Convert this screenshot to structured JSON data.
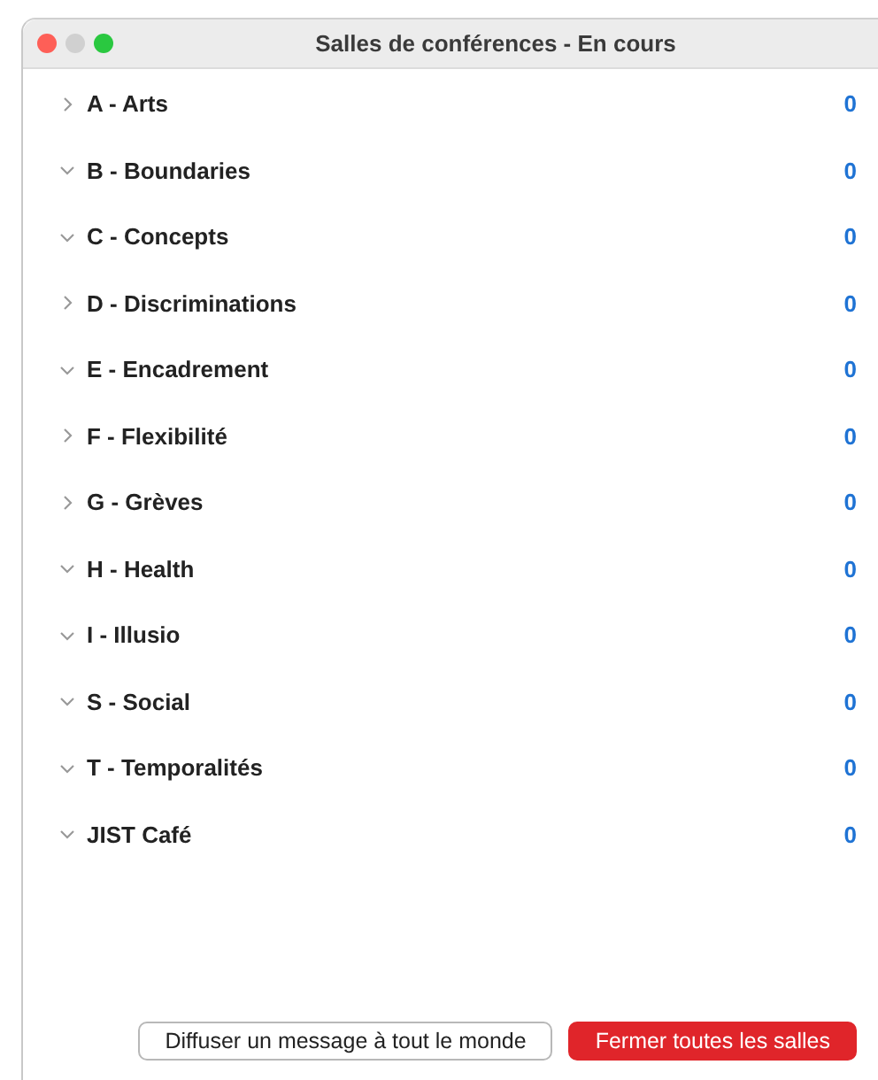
{
  "window": {
    "title": "Salles de conférences - En cours"
  },
  "rooms": [
    {
      "name": "A - Arts",
      "expanded": false,
      "count": "0"
    },
    {
      "name": "B - Boundaries",
      "expanded": true,
      "count": "0"
    },
    {
      "name": "C - Concepts",
      "expanded": true,
      "count": "0"
    },
    {
      "name": "D - Discriminations",
      "expanded": false,
      "count": "0"
    },
    {
      "name": "E - Encadrement",
      "expanded": true,
      "count": "0"
    },
    {
      "name": "F - Flexibilité",
      "expanded": false,
      "count": "0"
    },
    {
      "name": "G - Grèves",
      "expanded": false,
      "count": "0"
    },
    {
      "name": "H - Health",
      "expanded": true,
      "count": "0"
    },
    {
      "name": "I - Illusio",
      "expanded": true,
      "count": "0"
    },
    {
      "name": "S - Social",
      "expanded": true,
      "count": "0"
    },
    {
      "name": "T - Temporalités",
      "expanded": true,
      "count": "0"
    },
    {
      "name": "JIST Café",
      "expanded": true,
      "count": "0"
    }
  ],
  "buttons": [
    {
      "label": "Diffuser un message à tout le monde",
      "kind": "secondary"
    },
    {
      "label": "Fermer toutes les salles",
      "kind": "danger"
    }
  ]
}
